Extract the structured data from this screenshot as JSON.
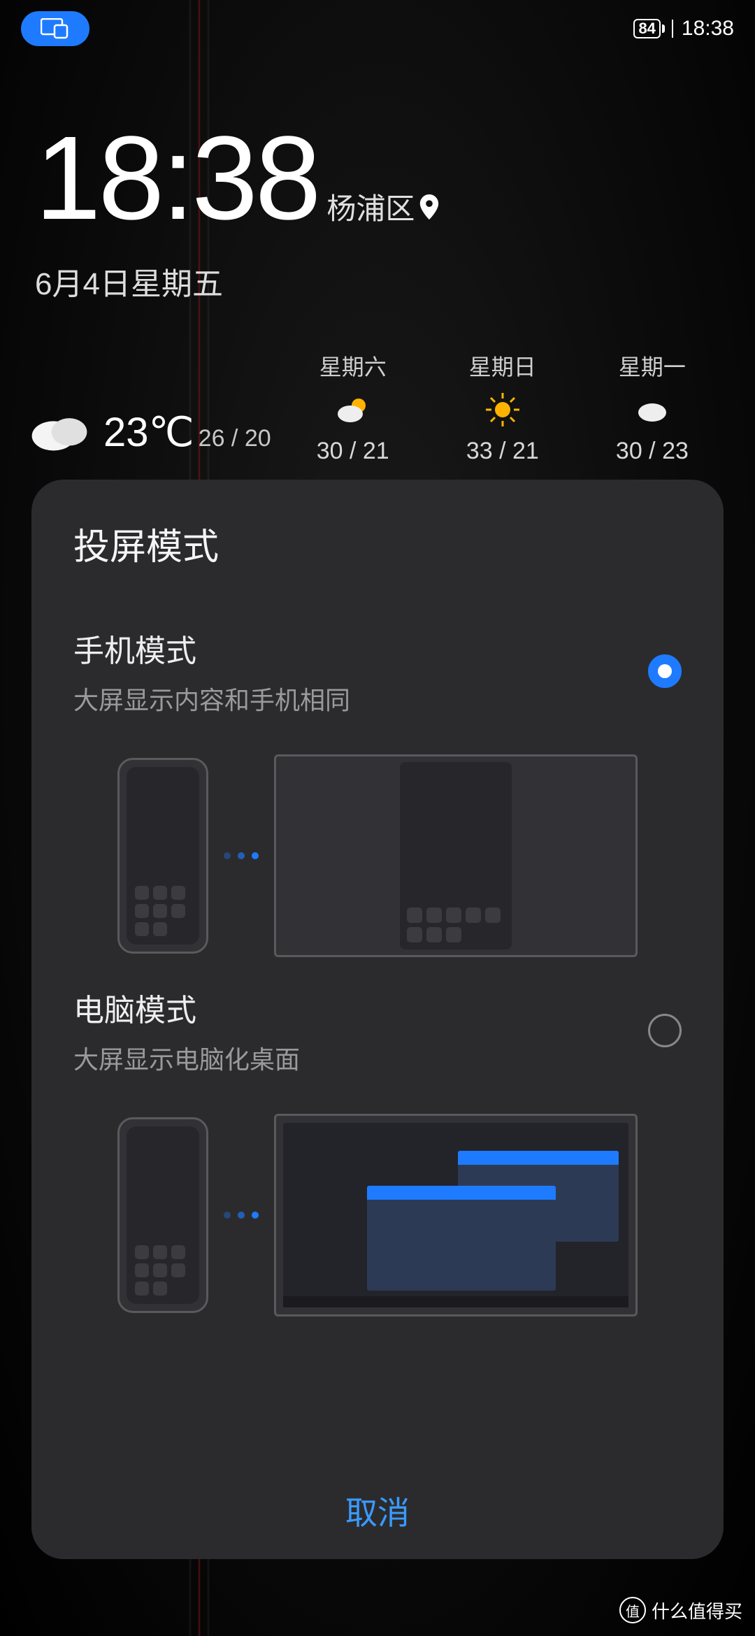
{
  "statusbar": {
    "battery": "84",
    "time": "18:38"
  },
  "clock": {
    "time": "18:38",
    "location": "杨浦区",
    "date": "6月4日星期五"
  },
  "weather": {
    "today": {
      "temp": "23℃",
      "range": "26 / 20",
      "icon": "cloudy"
    },
    "forecast": [
      {
        "day": "星期六",
        "range": "30 / 21",
        "icon": "partly"
      },
      {
        "day": "星期日",
        "range": "33 / 21",
        "icon": "sunny"
      },
      {
        "day": "星期一",
        "range": "30 / 23",
        "icon": "cloud"
      }
    ]
  },
  "sheet": {
    "title": "投屏模式",
    "options": [
      {
        "title": "手机模式",
        "desc": "大屏显示内容和手机相同",
        "selected": true
      },
      {
        "title": "电脑模式",
        "desc": "大屏显示电脑化桌面",
        "selected": false
      }
    ],
    "cancel": "取消"
  },
  "watermark": {
    "badge": "值",
    "text": "什么值得买"
  }
}
